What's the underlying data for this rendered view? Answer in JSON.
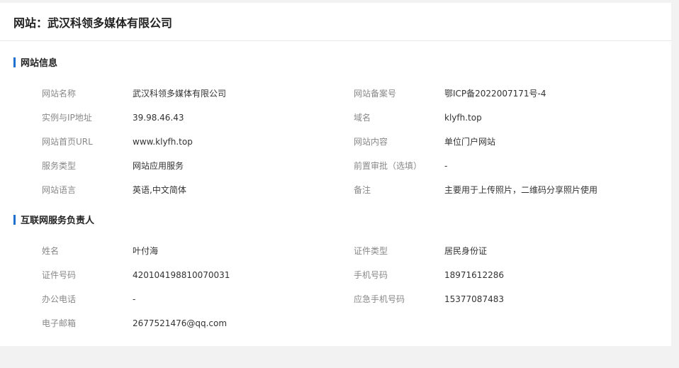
{
  "header": {
    "prefix": "网站：",
    "company": "武汉科领多媒体有限公司"
  },
  "website_info": {
    "title": "网站信息",
    "rows": [
      {
        "l1": "网站名称",
        "v1": "武汉科领多媒体有限公司",
        "l2": "网站备案号",
        "v2": "鄂ICP备2022007171号-4"
      },
      {
        "l1": "实例与IP地址",
        "v1": "39.98.46.43",
        "l2": "域名",
        "v2": "klyfh.top"
      },
      {
        "l1": "网站首页URL",
        "v1": "www.klyfh.top",
        "l2": "网站内容",
        "v2": "单位门户网站"
      },
      {
        "l1": "服务类型",
        "v1": "网站应用服务",
        "l2": "前置审批（选填）",
        "v2": "-"
      },
      {
        "l1": "网站语言",
        "v1": "英语,中文简体",
        "l2": "备注",
        "v2": "主要用于上传照片，二维码分享照片使用"
      }
    ]
  },
  "responsible": {
    "title": "互联网服务负责人",
    "rows": [
      {
        "l1": "姓名",
        "v1": "叶付海",
        "l2": "证件类型",
        "v2": "居民身份证"
      },
      {
        "l1": "证件号码",
        "v1": "420104198810070031",
        "l2": "手机号码",
        "v2": "18971612286"
      },
      {
        "l1": "办公电话",
        "v1": "-",
        "l2": "应急手机号码",
        "v2": "15377087483"
      },
      {
        "l1": "电子邮箱",
        "v1": "2677521476@qq.com",
        "l2": "",
        "v2": ""
      }
    ]
  },
  "colors": {
    "accent": "#1f6fd1",
    "label": "#888888",
    "value": "#333333",
    "background": "#f2f2f2"
  }
}
